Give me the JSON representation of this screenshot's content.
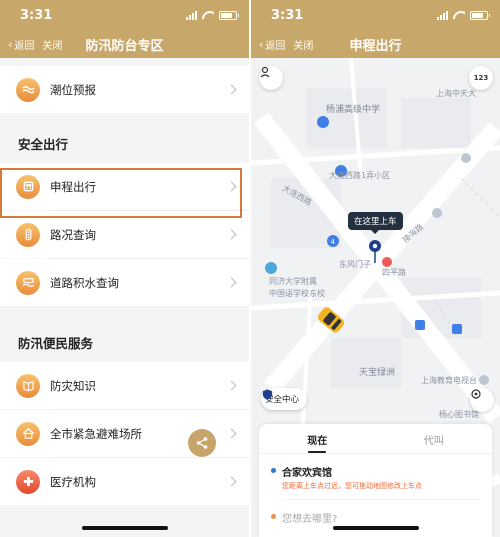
{
  "left": {
    "status": {
      "time": "3:31"
    },
    "nav": {
      "back": "返回",
      "close": "关闭",
      "title": "防汛防台专区"
    },
    "items_top": [
      {
        "label": "潮位预报",
        "icon": "tide-icon"
      }
    ],
    "section1": {
      "title": "安全出行",
      "items": [
        {
          "label": "申程出行",
          "icon": "taxi-icon"
        },
        {
          "label": "路况查询",
          "icon": "traffic-light-icon"
        },
        {
          "label": "道路积水查询",
          "icon": "flooded-road-icon"
        }
      ]
    },
    "section2": {
      "title": "防汛便民服务",
      "items": [
        {
          "label": "防灾知识",
          "icon": "book-icon"
        },
        {
          "label": "全市紧急避难场所",
          "icon": "shelter-icon"
        },
        {
          "label": "医疗机构",
          "icon": "medical-cross-icon",
          "color": "#e1482d"
        }
      ]
    },
    "colors": {
      "header": "#c8a86a",
      "highlight": "#d8783a"
    }
  },
  "right": {
    "status": {
      "time": "3:31"
    },
    "nav": {
      "back": "返回",
      "close": "关闭",
      "title": "申程出行"
    },
    "map": {
      "labels": [
        "杨浦高级中学",
        "大连西路1弄小区",
        "东风门子",
        "四平路",
        "同济大学附属",
        "中国语学校东校",
        "天宝绿洲",
        "上海教育电视台",
        "上海中天大",
        "杨心图书馆",
        "接海路",
        "大连西路"
      ],
      "tooltip": "在这里上车",
      "zoom_badge": "123"
    },
    "safety_center": "安全中心",
    "sheet": {
      "tabs": [
        {
          "label": "现在",
          "active": true
        },
        {
          "label": "代叫",
          "active": false
        }
      ],
      "pickup": {
        "name": "合家欢宾馆",
        "hint": "您距离上车点过远，您可拖动地图修改上车点"
      },
      "destination_placeholder": "您想去哪里?"
    },
    "colors": {
      "pickup_dot": "#2f74d8",
      "dest_dot": "#f0904a",
      "pin": "#1f3f8c",
      "taxi": "#f1b320"
    }
  }
}
